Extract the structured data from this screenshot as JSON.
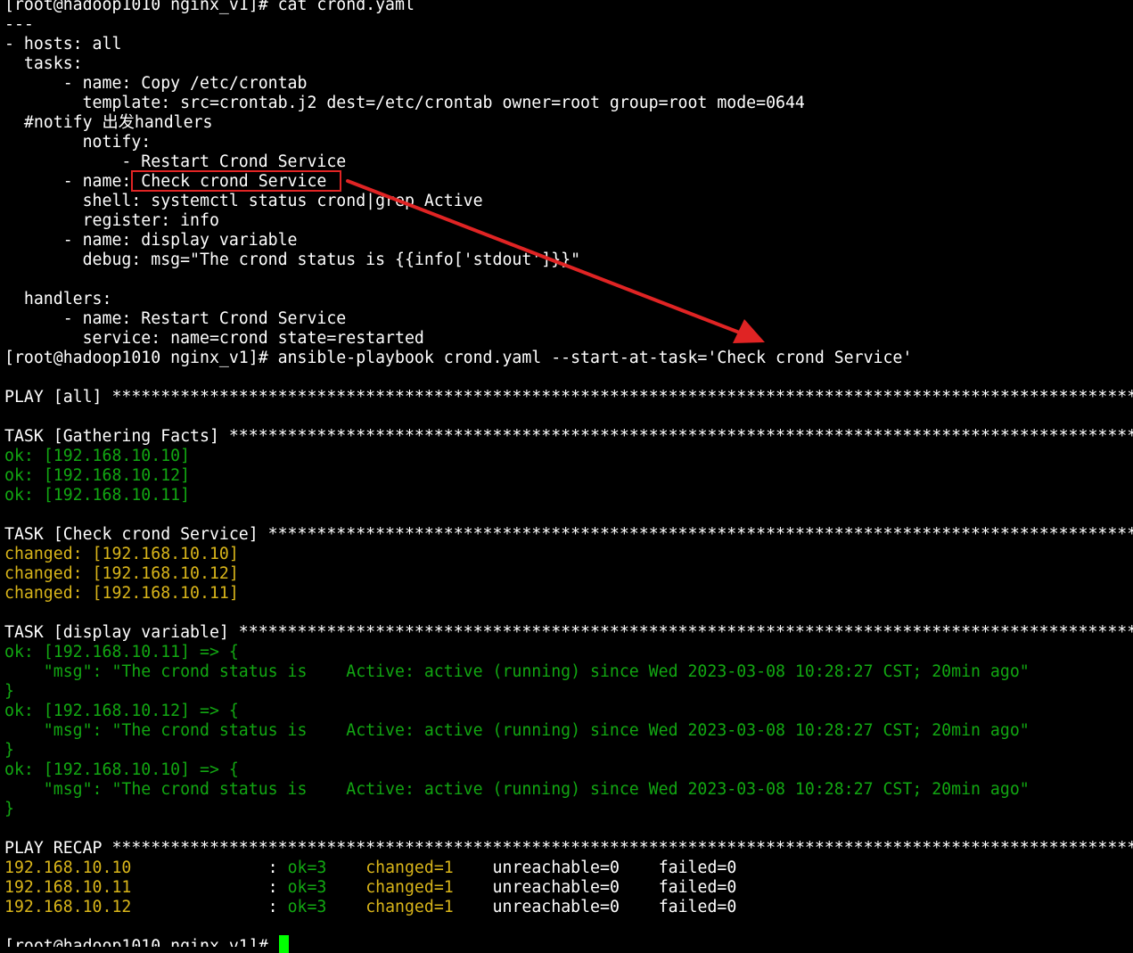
{
  "terminal": {
    "lines": [
      {
        "segs": [
          {
            "t": "[root@hadoop1010 nginx_v1]# cat crond.yaml",
            "c": "white"
          }
        ]
      },
      {
        "segs": [
          {
            "t": "---",
            "c": "white"
          }
        ]
      },
      {
        "segs": [
          {
            "t": "- hosts: all",
            "c": "white"
          }
        ]
      },
      {
        "segs": [
          {
            "t": "  tasks:",
            "c": "white"
          }
        ]
      },
      {
        "segs": [
          {
            "t": "      - name: Copy /etc/crontab",
            "c": "white"
          }
        ]
      },
      {
        "segs": [
          {
            "t": "        template: src=crontab.j2 dest=/etc/crontab owner=root group=root mode=0644",
            "c": "white"
          }
        ]
      },
      {
        "segs": [
          {
            "t": "  #notify 出发handlers",
            "c": "white"
          }
        ]
      },
      {
        "segs": [
          {
            "t": "        notify:",
            "c": "white"
          }
        ]
      },
      {
        "segs": [
          {
            "t": "            - Restart Crond Service",
            "c": "white"
          }
        ]
      },
      {
        "segs": [
          {
            "t": "      - name: Check crond Service",
            "c": "white"
          }
        ]
      },
      {
        "segs": [
          {
            "t": "        shell: systemctl status crond|grep Active",
            "c": "white"
          }
        ]
      },
      {
        "segs": [
          {
            "t": "        register: info",
            "c": "white"
          }
        ]
      },
      {
        "segs": [
          {
            "t": "      - name: display variable",
            "c": "white"
          }
        ]
      },
      {
        "segs": [
          {
            "t": "        debug: msg=\"The crond status is {{info['stdout']}}\"",
            "c": "white"
          }
        ]
      },
      {
        "segs": [
          {
            "t": "",
            "c": "white"
          }
        ]
      },
      {
        "segs": [
          {
            "t": "  handlers:",
            "c": "white"
          }
        ]
      },
      {
        "segs": [
          {
            "t": "      - name: Restart Crond Service",
            "c": "white"
          }
        ]
      },
      {
        "segs": [
          {
            "t": "        service: name=crond state=restarted",
            "c": "white"
          }
        ]
      },
      {
        "segs": [
          {
            "t": "[root@hadoop1010 nginx_v1]# ansible-playbook crond.yaml --start-at-task='Check crond Service'",
            "c": "white"
          }
        ]
      },
      {
        "segs": [
          {
            "t": "",
            "c": "white"
          }
        ]
      },
      {
        "segs": [
          {
            "t": "PLAY [all] ",
            "c": "white"
          }
        ],
        "stars": true
      },
      {
        "segs": [
          {
            "t": "",
            "c": "white"
          }
        ]
      },
      {
        "segs": [
          {
            "t": "TASK [Gathering Facts] ",
            "c": "white"
          }
        ],
        "stars": true
      },
      {
        "segs": [
          {
            "t": "ok: [192.168.10.10]",
            "c": "green"
          }
        ]
      },
      {
        "segs": [
          {
            "t": "ok: [192.168.10.12]",
            "c": "green"
          }
        ]
      },
      {
        "segs": [
          {
            "t": "ok: [192.168.10.11]",
            "c": "green"
          }
        ]
      },
      {
        "segs": [
          {
            "t": "",
            "c": "white"
          }
        ]
      },
      {
        "segs": [
          {
            "t": "TASK [Check crond Service] ",
            "c": "white"
          }
        ],
        "stars": true
      },
      {
        "segs": [
          {
            "t": "changed: [192.168.10.10]",
            "c": "yellow"
          }
        ]
      },
      {
        "segs": [
          {
            "t": "changed: [192.168.10.12]",
            "c": "yellow"
          }
        ]
      },
      {
        "segs": [
          {
            "t": "changed: [192.168.10.11]",
            "c": "yellow"
          }
        ]
      },
      {
        "segs": [
          {
            "t": "",
            "c": "white"
          }
        ]
      },
      {
        "segs": [
          {
            "t": "TASK [display variable] ",
            "c": "white"
          }
        ],
        "stars": true
      },
      {
        "segs": [
          {
            "t": "ok: [192.168.10.11] => {",
            "c": "green"
          }
        ]
      },
      {
        "segs": [
          {
            "t": "    \"msg\": \"The crond status is    Active: active (running) since Wed 2023-03-08 10:28:27 CST; 20min ago\"",
            "c": "green"
          }
        ]
      },
      {
        "segs": [
          {
            "t": "}",
            "c": "green"
          }
        ]
      },
      {
        "segs": [
          {
            "t": "ok: [192.168.10.12] => {",
            "c": "green"
          }
        ]
      },
      {
        "segs": [
          {
            "t": "    \"msg\": \"The crond status is    Active: active (running) since Wed 2023-03-08 10:28:27 CST; 20min ago\"",
            "c": "green"
          }
        ]
      },
      {
        "segs": [
          {
            "t": "}",
            "c": "green"
          }
        ]
      },
      {
        "segs": [
          {
            "t": "ok: [192.168.10.10] => {",
            "c": "green"
          }
        ]
      },
      {
        "segs": [
          {
            "t": "    \"msg\": \"The crond status is    Active: active (running) since Wed 2023-03-08 10:28:27 CST; 20min ago\"",
            "c": "green"
          }
        ]
      },
      {
        "segs": [
          {
            "t": "}",
            "c": "green"
          }
        ]
      },
      {
        "segs": [
          {
            "t": "",
            "c": "white"
          }
        ]
      },
      {
        "segs": [
          {
            "t": "PLAY RECAP ",
            "c": "white"
          }
        ],
        "stars": true
      },
      {
        "segs": [
          {
            "t": "192.168.10.10",
            "c": "yellow"
          },
          {
            "t": "              : ",
            "c": "white"
          },
          {
            "t": "ok=3",
            "c": "green"
          },
          {
            "t": "    ",
            "c": "white"
          },
          {
            "t": "changed=1",
            "c": "yellow"
          },
          {
            "t": "    unreachable=0    failed=0",
            "c": "white"
          }
        ]
      },
      {
        "segs": [
          {
            "t": "192.168.10.11",
            "c": "yellow"
          },
          {
            "t": "              : ",
            "c": "white"
          },
          {
            "t": "ok=3",
            "c": "green"
          },
          {
            "t": "    ",
            "c": "white"
          },
          {
            "t": "changed=1",
            "c": "yellow"
          },
          {
            "t": "    unreachable=0    failed=0",
            "c": "white"
          }
        ]
      },
      {
        "segs": [
          {
            "t": "192.168.10.12",
            "c": "yellow"
          },
          {
            "t": "              : ",
            "c": "white"
          },
          {
            "t": "ok=3",
            "c": "green"
          },
          {
            "t": "    ",
            "c": "white"
          },
          {
            "t": "changed=1",
            "c": "yellow"
          },
          {
            "t": "    unreachable=0    failed=0",
            "c": "white"
          }
        ]
      },
      {
        "segs": [
          {
            "t": "",
            "c": "white"
          }
        ]
      },
      {
        "segs": [
          {
            "t": "[root@hadoop1010 nginx_v1]# ",
            "c": "white"
          }
        ]
      }
    ],
    "stars_text": "****************************************************************************************************************************",
    "colors": {
      "background": "#000000",
      "text": "#ffffff",
      "ok": "#12a712",
      "changed": "#d9b51a",
      "annotation": "#e02424",
      "cursor": "#00ff00"
    }
  },
  "annotations": {
    "highlight_icon": "red-rectangle-icon",
    "arrow_icon": "red-arrow-icon"
  }
}
